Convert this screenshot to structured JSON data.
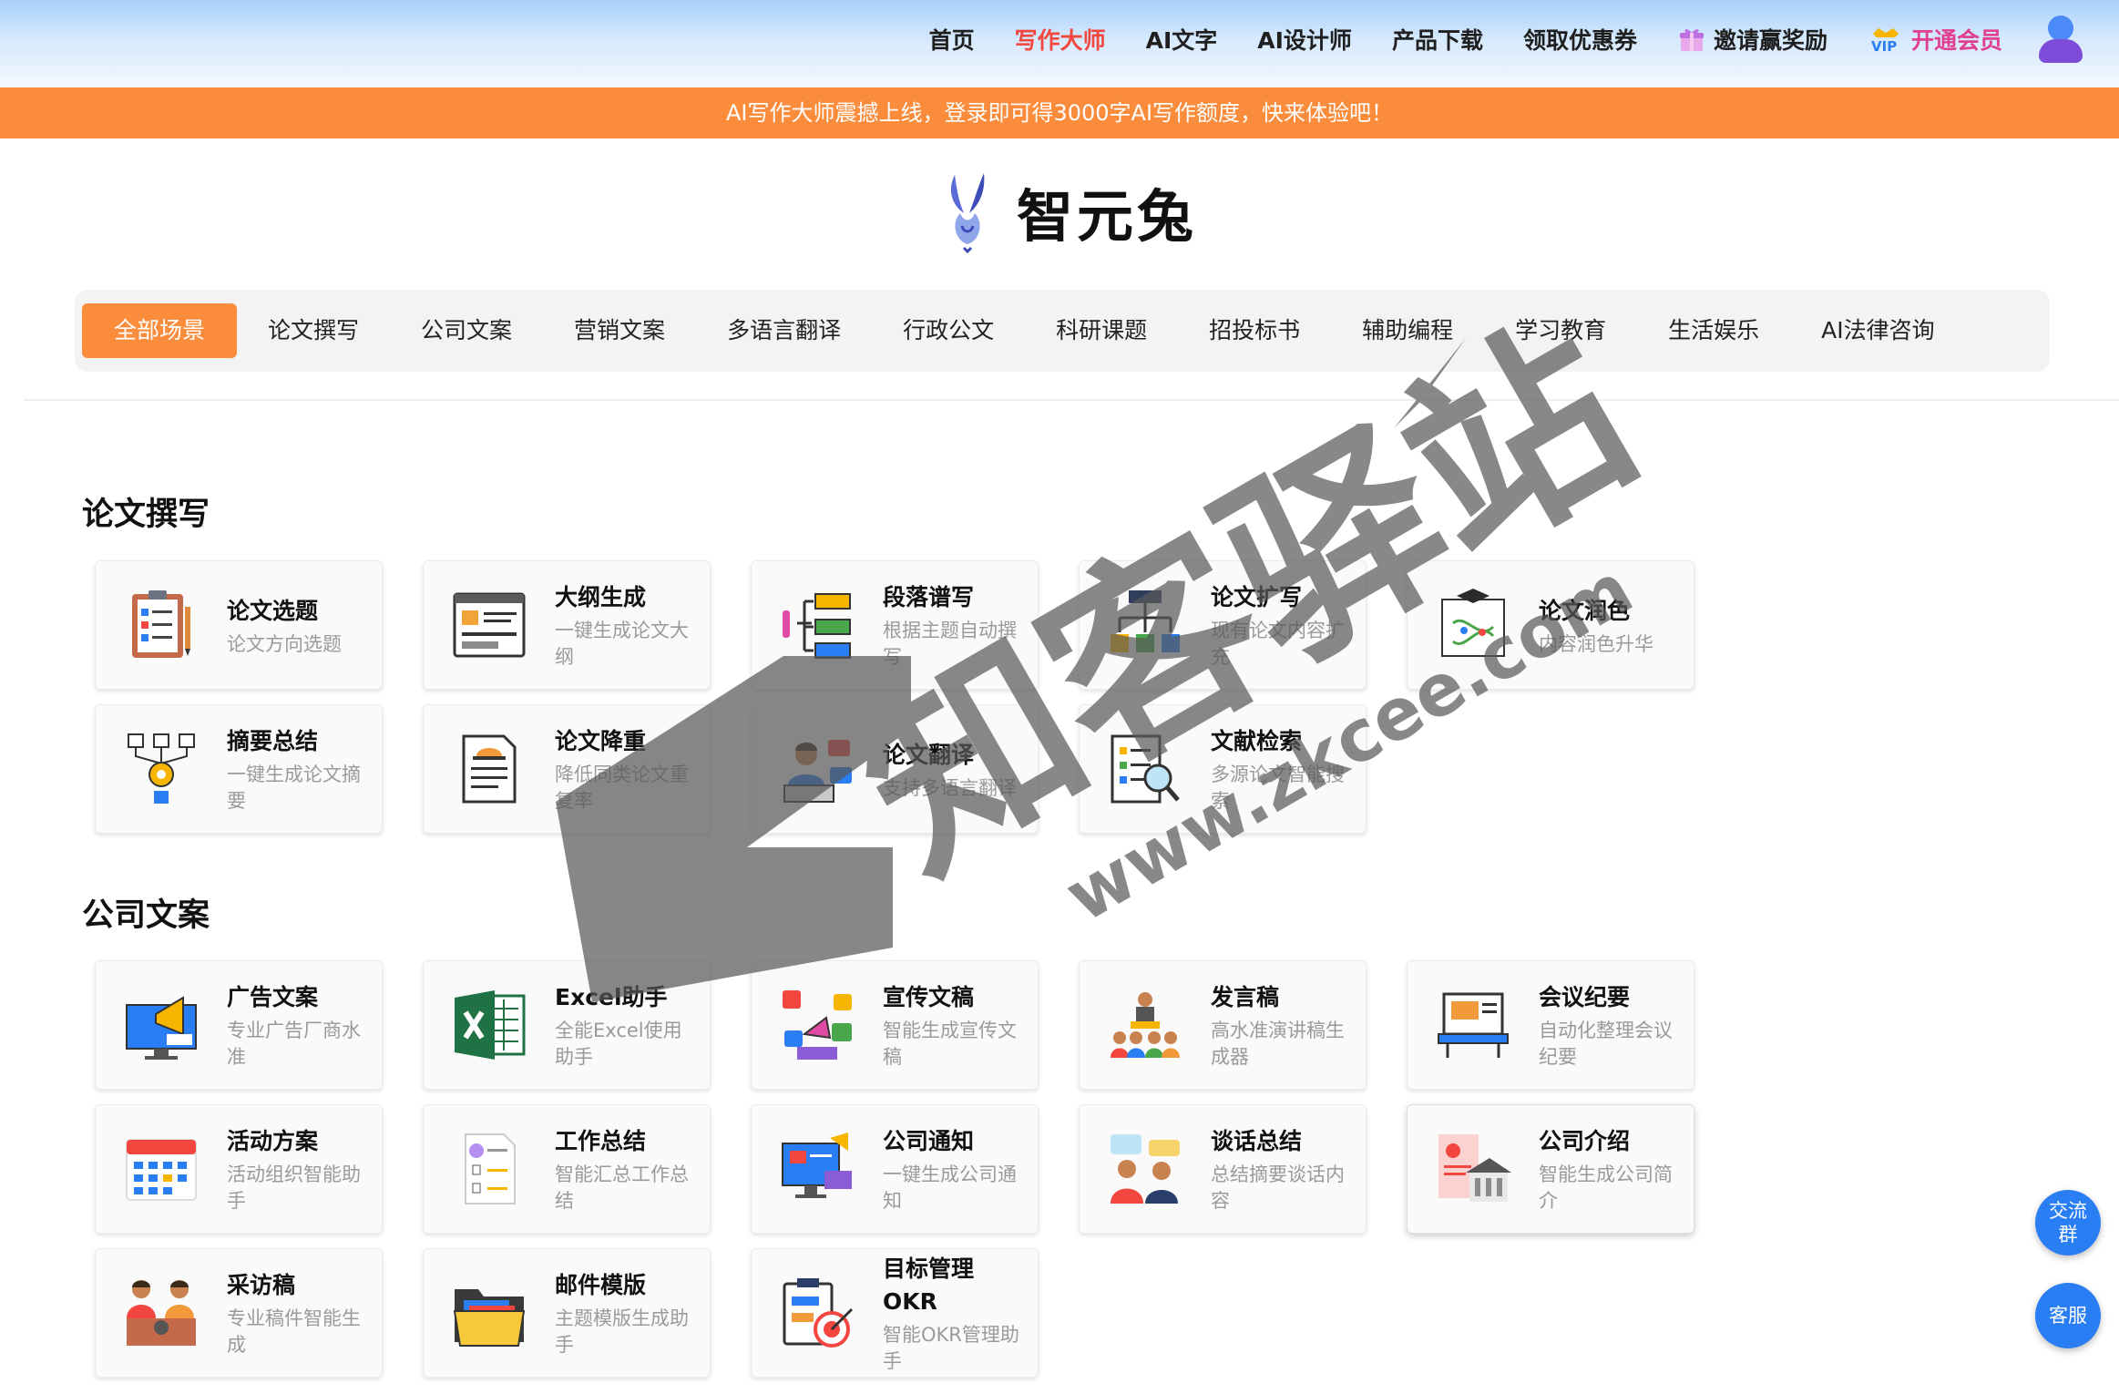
{
  "nav": {
    "items": [
      "首页",
      "写作大师",
      "AI文字",
      "AI设计师",
      "产品下载",
      "领取优惠券"
    ],
    "invite": "邀请赢奖励",
    "vip_badge": "VIP",
    "vip": "开通会员",
    "accent": "#f2463f"
  },
  "banner": {
    "text": "AI写作大师震撼上线，登录即可得3000字AI写作额度，快来体验吧！",
    "color": "#fb8c3c"
  },
  "logo": {
    "text": "智元兔"
  },
  "tabs": [
    "全部场景",
    "论文撰写",
    "公司文案",
    "营销文案",
    "多语言翻译",
    "行政公文",
    "科研课题",
    "招投标书",
    "辅助编程",
    "学习教育",
    "生活娱乐",
    "AI法律咨询"
  ],
  "sections": [
    {
      "title": "论文撰写",
      "cards": [
        {
          "title": "论文选题",
          "desc": "论文方向选题",
          "icon": "clipboard-checklist-icon"
        },
        {
          "title": "大纲生成",
          "desc": "一键生成论文大纲",
          "icon": "outline-browser-icon"
        },
        {
          "title": "段落谱写",
          "desc": "根据主题自动撰写",
          "icon": "paragraph-tree-icon"
        },
        {
          "title": "论文扩写",
          "desc": "现有论文内容扩充",
          "icon": "expand-hierarchy-icon"
        },
        {
          "title": "论文润色",
          "desc": "内容润色升华",
          "icon": "graduation-dna-icon"
        },
        {
          "title": "摘要总结",
          "desc": "一键生成论文摘要",
          "icon": "gear-flow-icon"
        },
        {
          "title": "论文降重",
          "desc": "降低同类论文重复率",
          "icon": "document-helmet-icon"
        },
        {
          "title": "论文翻译",
          "desc": "支持多语言翻译",
          "icon": "translator-person-icon"
        },
        {
          "title": "文献检索",
          "desc": "多源论文智能搜索",
          "icon": "document-search-icon"
        }
      ]
    },
    {
      "title": "公司文案",
      "cards": [
        {
          "title": "广告文案",
          "desc": "专业广告厂商水准",
          "icon": "megaphone-monitor-icon"
        },
        {
          "title": "Excel助手",
          "desc": "全能Excel使用助手",
          "icon": "excel-icon"
        },
        {
          "title": "宣传文稿",
          "desc": "智能生成宣传文稿",
          "icon": "promotion-phone-icon"
        },
        {
          "title": "发言稿",
          "desc": "高水准演讲稿生成器",
          "icon": "speaker-audience-icon"
        },
        {
          "title": "会议纪要",
          "desc": "自动化整理会议纪要",
          "icon": "meeting-laptop-icon"
        },
        {
          "title": "活动方案",
          "desc": "活动组织智能助手",
          "icon": "calendar-icon"
        },
        {
          "title": "工作总结",
          "desc": "智能汇总工作总结",
          "icon": "numbered-list-icon"
        },
        {
          "title": "公司通知",
          "desc": "一键生成公司通知",
          "icon": "notification-monitor-icon"
        },
        {
          "title": "谈话总结",
          "desc": "总结摘要谈话内容",
          "icon": "conversation-icon"
        },
        {
          "title": "公司介绍",
          "desc": "智能生成公司简介",
          "icon": "company-building-icon"
        },
        {
          "title": "采访稿",
          "desc": "专业稿件智能生成",
          "icon": "interview-icon"
        },
        {
          "title": "邮件模版",
          "desc": "主题模版生成助手",
          "icon": "folder-mail-icon"
        },
        {
          "title": "目标管理OKR",
          "desc": "智能OKR管理助手",
          "icon": "target-clipboard-icon"
        }
      ]
    }
  ],
  "float": {
    "group": "交流群",
    "service": "客服"
  },
  "watermark": {
    "brand": "知客驿站",
    "url": "www.zkcee.com"
  }
}
